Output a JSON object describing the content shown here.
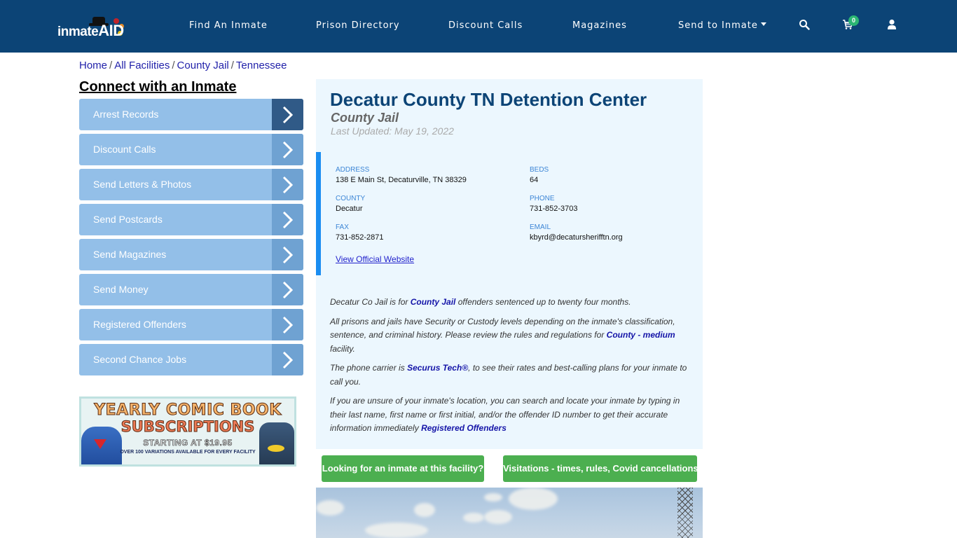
{
  "brand": {
    "logo_text_main": "inmate",
    "logo_text_accent": "AID"
  },
  "nav": {
    "links": [
      {
        "label": "Find An Inmate"
      },
      {
        "label": "Prison Directory"
      },
      {
        "label": "Discount Calls"
      },
      {
        "label": "Magazines"
      },
      {
        "label": "Send to Inmate"
      }
    ],
    "cart_count": "0",
    "icons": [
      "search-icon",
      "cart-icon",
      "user-icon"
    ],
    "bg_color": "#0c4476"
  },
  "breadcrumb": {
    "items": [
      "Home",
      "All Facilities",
      "County Jail",
      "Tennessee"
    ],
    "separator": "/"
  },
  "sidebar": {
    "title": "Connect with an Inmate",
    "items": [
      {
        "label": "Arrest Records"
      },
      {
        "label": "Discount Calls"
      },
      {
        "label": "Send Letters & Photos"
      },
      {
        "label": "Send Postcards"
      },
      {
        "label": "Send Magazines"
      },
      {
        "label": "Send Money"
      },
      {
        "label": "Registered Offenders"
      },
      {
        "label": "Second Chance Jobs"
      }
    ],
    "banner": {
      "line1": "YEARLY COMIC BOOK",
      "line2": "SUBSCRIPTIONS",
      "line3": "STARTING AT $19.95",
      "line4": "OVER 100 VARIATIONS AVAILABLE FOR EVERY FACILITY"
    }
  },
  "facility": {
    "name": "Decatur County TN Detention Center",
    "type": "County Jail",
    "last_updated": "Last Updated: May 19, 2022",
    "fields": {
      "address": {
        "label": "ADDRESS",
        "value": "138 E Main St, Decaturville, TN 38329"
      },
      "beds": {
        "label": "BEDS",
        "value": "64"
      },
      "county": {
        "label": "COUNTY",
        "value": "Decatur"
      },
      "phone": {
        "label": "PHONE",
        "value": "731-852-3703"
      },
      "fax": {
        "label": "FAX",
        "value": "731-852-2871"
      },
      "email": {
        "label": "EMAIL",
        "value": "kbyrd@decatursherifftn.org"
      }
    },
    "official_website_label": "View Official Website",
    "description": {
      "p1_a": "Decatur Co Jail is for ",
      "p1_link": "County Jail",
      "p1_b": " offenders sentenced up to twenty four months.",
      "p2_a": "All prisons and jails have Security or Custody levels depending on the inmate's classification, sentence, and criminal history. Please review the rules and regulations for ",
      "p2_link": "County - medium",
      "p2_b": " facility.",
      "p3_a": "The phone carrier is ",
      "p3_link": "Securus Tech®",
      "p3_b": ", to see their rates and best-calling plans for your inmate to call you.",
      "p4_a": "If you are unsure of your inmate's location, you can search and locate your inmate by typing in their last name, first name or first initial, and/or the offender ID number to get their accurate information immediately ",
      "p4_link": "Registered Offenders"
    }
  },
  "actions": {
    "find_inmate_label": "Looking for an inmate at this facility?",
    "visitation_label": "Visitations - times, rules, Covid cancellations",
    "button_color": "#4caf50"
  }
}
